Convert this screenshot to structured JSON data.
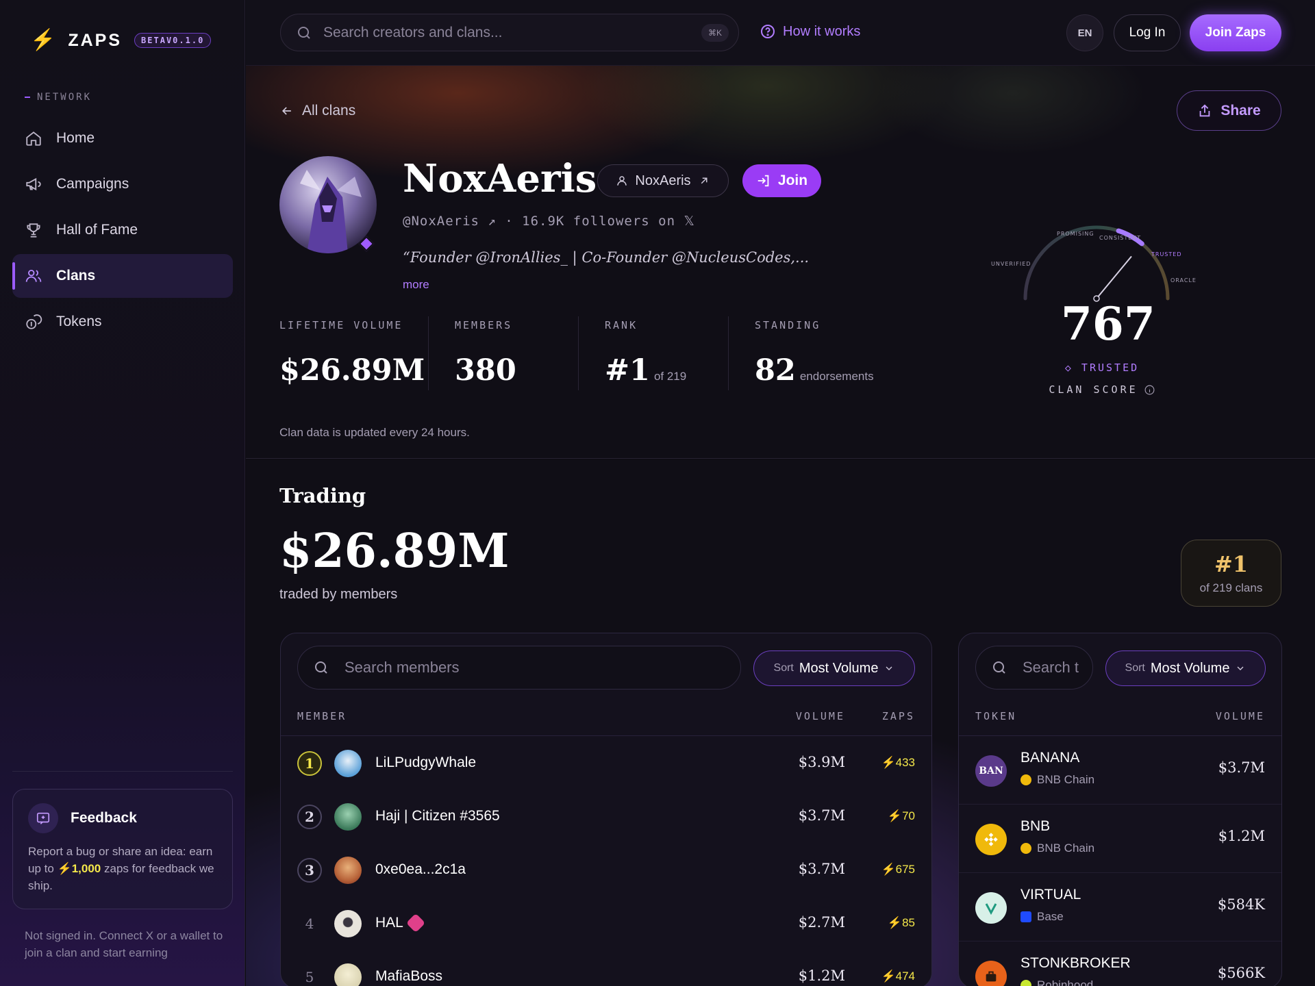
{
  "brand": {
    "name": "ZAPS",
    "badge": "BETAV0.1.0"
  },
  "sidebar": {
    "heading": "NETWORK",
    "items": [
      {
        "label": "Home",
        "icon": "home-icon"
      },
      {
        "label": "Campaigns",
        "icon": "megaphone-icon"
      },
      {
        "label": "Hall of Fame",
        "icon": "trophy-icon"
      },
      {
        "label": "Clans",
        "icon": "users-icon",
        "active": true
      },
      {
        "label": "Tokens",
        "icon": "coins-icon"
      }
    ],
    "feedback": {
      "title": "Feedback",
      "text_before": "Report a bug or share an idea: earn up to ",
      "highlight": "⚡1,000",
      "text_after": " zaps for feedback we ship."
    },
    "not_signed": "Not signed in. Connect X or a wallet to join a clan and start earning"
  },
  "topbar": {
    "search_placeholder": "Search creators and clans...",
    "shortcut": "⌘K",
    "how_it_works": "How it works",
    "lang": "EN",
    "login": "Log In",
    "join": "Join Zaps"
  },
  "clan": {
    "back": "All clans",
    "share": "Share",
    "name": "NoxAeris",
    "handle_pill": "NoxAeris",
    "join": "Join",
    "followers_line": "@NoxAeris ↗ · 16.9K followers on 𝕏",
    "bio": "“Founder @IronAllies_ | Co-Founder @NucleusCodes,...",
    "more": "more",
    "stats": [
      {
        "label": "LIFETIME VOLUME",
        "value": "$26.89M",
        "sub": ""
      },
      {
        "label": "MEMBERS",
        "value": "380",
        "sub": ""
      },
      {
        "label": "RANK",
        "value": "#1",
        "sub": "of 219"
      },
      {
        "label": "STANDING",
        "value": "82",
        "sub": "endorsements"
      }
    ],
    "updated": "Clan data is updated every 24 hours.",
    "score": {
      "value": "767",
      "status": "◇ TRUSTED",
      "label": "CLAN SCORE",
      "gauge_fraction": 0.72,
      "gauge_labels": [
        "UNVERIFIED",
        "PROMISING",
        "CONSISTENT",
        "TRUSTED",
        "ORACLE"
      ]
    }
  },
  "trading": {
    "title": "Trading",
    "amount": "$26.89M",
    "subtitle": "traded by members",
    "rank": "#1",
    "rank_of": "of 219 clans"
  },
  "members_panel": {
    "search_placeholder": "Search members",
    "sort_key": "Sort",
    "sort_value": "Most Volume",
    "headers": {
      "member": "MEMBER",
      "volume": "VOLUME",
      "zaps": "ZAPS"
    },
    "rows": [
      {
        "rank": "1",
        "name": "LiLPudgyWhale",
        "volume": "$3.9M",
        "zaps": "⚡433",
        "color": "#5aa0d8"
      },
      {
        "rank": "2",
        "name": "Haji | Citizen #3565",
        "volume": "$3.7M",
        "zaps": "⚡70",
        "color": "#3b7a5a"
      },
      {
        "rank": "3",
        "name": "0xe0ea...2c1a",
        "volume": "$3.7M",
        "zaps": "⚡675",
        "color": "#b8643a"
      },
      {
        "rank": "4",
        "name": "HAL",
        "volume": "$2.7M",
        "zaps": "⚡85",
        "color": "#e8e4dc"
      },
      {
        "rank": "5",
        "name": "MafiaBoss",
        "volume": "$1.2M",
        "zaps": "⚡474",
        "color": "#d9d2b0"
      }
    ]
  },
  "tokens_panel": {
    "search_placeholder": "Search t",
    "sort_key": "Sort",
    "sort_value": "Most Volume",
    "headers": {
      "token": "TOKEN",
      "volume": "VOLUME"
    },
    "rows": [
      {
        "logo": "BAN",
        "name": "BANANA",
        "chain": "BNB Chain",
        "volume": "$3.7M",
        "color": "#5a3a8a",
        "chain_color": "#f0b90b"
      },
      {
        "logo": "",
        "name": "BNB",
        "chain": "BNB Chain",
        "volume": "$1.2M",
        "color": "#f0b90b",
        "chain_color": "#f0b90b"
      },
      {
        "logo": "",
        "name": "VIRTUAL",
        "chain": "Base",
        "volume": "$584K",
        "color": "#d8f0e8",
        "chain_color": "#1f4bff"
      },
      {
        "logo": "",
        "name": "STONKBROKER",
        "chain": "Robinhood",
        "volume": "$566K",
        "color": "#e8621a",
        "chain_color": "#c8e830"
      }
    ]
  }
}
